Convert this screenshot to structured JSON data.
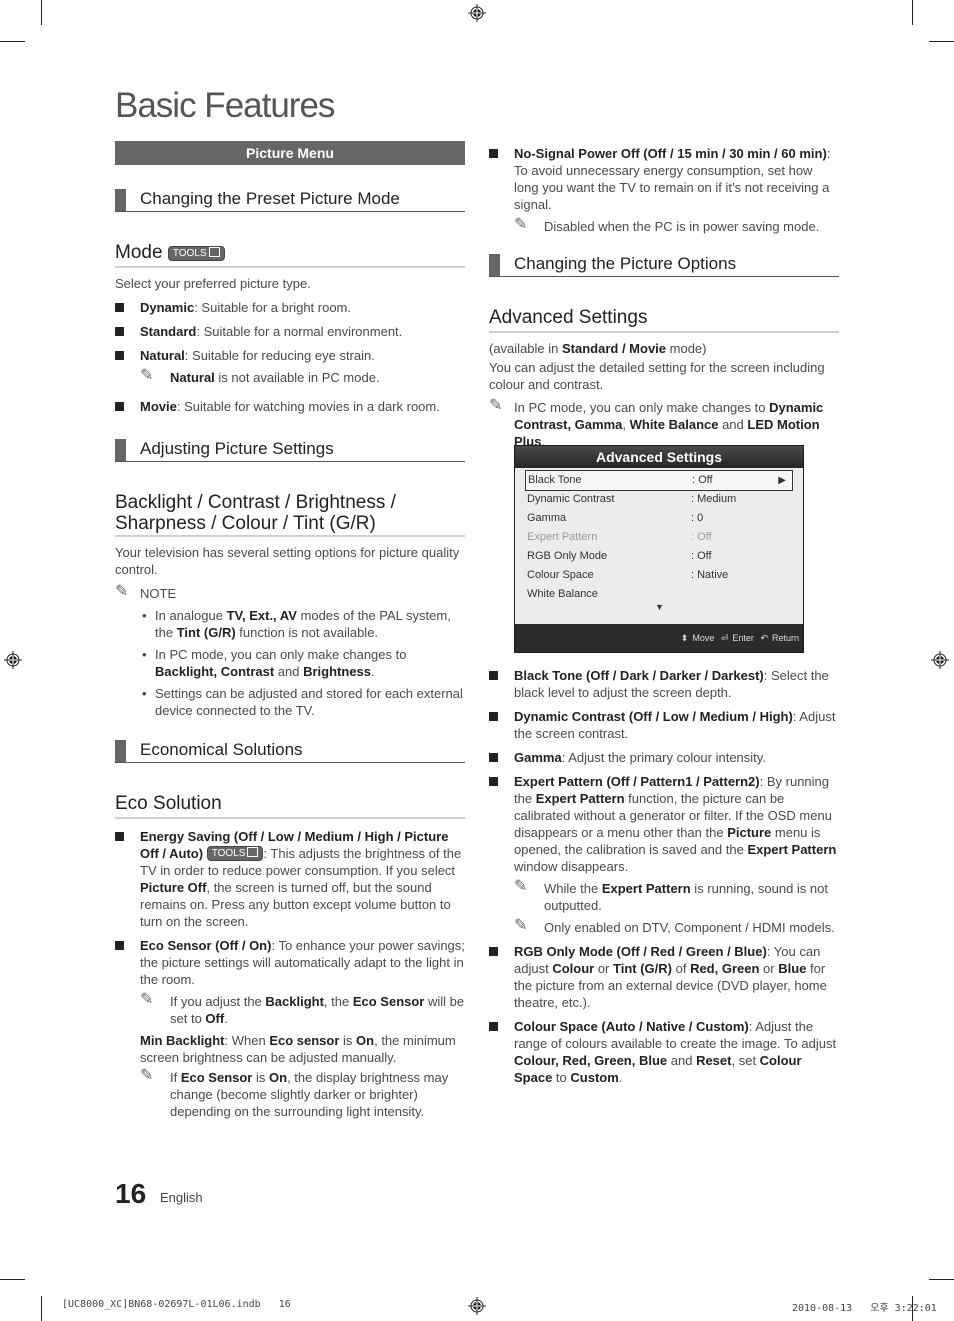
{
  "page": {
    "title": "Basic Features",
    "page_number": "16",
    "language": "English",
    "slug_left": "[UC8000_XC]BN68-02697L-01L06.indb   16",
    "slug_right": "2010-08-13   오후 3:22:01"
  },
  "left": {
    "menu_bar": "Picture Menu",
    "sec1": "Changing the Preset Picture Mode",
    "mode_heading": "Mode",
    "tools_label": "TOOLS",
    "mode_intro": "Select your preferred picture type.",
    "mode_items": [
      {
        "term": "Dynamic",
        "text": ": Suitable for a bright room."
      },
      {
        "term": "Standard",
        "text": ": Suitable for a normal environment."
      },
      {
        "term": "Natural",
        "text": ": Suitable for reducing eye strain."
      },
      {
        "term": "Movie",
        "text": ": Suitable for watching movies in a dark room."
      }
    ],
    "natural_note_term": "Natural",
    "natural_note_text": " is not available in PC mode.",
    "sec2": "Adjusting Picture Settings",
    "backlight_heading_l1": "Backlight / Contrast / Brightness /",
    "backlight_heading_l2": "Sharpness / Colour / Tint (G/R)",
    "backlight_intro": "Your television has several setting options for picture quality control.",
    "note_label": "NOTE",
    "notes": {
      "n1a": "In analogue ",
      "n1b": "TV, Ext., AV",
      "n1c": " modes of the PAL system, the ",
      "n1d": "Tint (G/R)",
      "n1e": " function is not available.",
      "n2a": "In PC mode, you can only make changes to ",
      "n2b": "Backlight, Contrast",
      "n2c": " and ",
      "n2d": "Brightness",
      "n2e": ".",
      "n3": "Settings can be adjusted and stored for each external device connected to the TV."
    },
    "sec3": "Economical Solutions",
    "eco_heading": "Eco Solution",
    "energy": {
      "term1": "Energy Saving (Off / Low / Medium / High / Picture Off / Auto)",
      "t1": ": This adjusts the brightness of the TV in order to reduce power consumption. If you select ",
      "term2": "Picture Off",
      "t2": ", the screen is turned off, but the sound remains on. Press any button except volume button to turn on the screen."
    },
    "eco_sensor": {
      "term": "Eco Sensor (Off / On)",
      "text": ": To enhance your power savings; the picture settings will automatically adapt to the light in the room.",
      "note_a": " If you adjust the ",
      "note_b": "Backlight",
      "note_c": ", the ",
      "note_d": "Eco Sensor",
      "note_e": " will be set to ",
      "note_f": "Off",
      "note_g": ".",
      "min_a": "Min Backlight",
      "min_b": ": When ",
      "min_c": "Eco sensor",
      "min_d": " is ",
      "min_e": "On",
      "min_f": ", the minimum screen brightness can be adjusted manually.",
      "note2_a": "If ",
      "note2_b": "Eco Sensor",
      "note2_c": " is ",
      "note2_d": "On",
      "note2_e": ", the display brightness may change (become slightly darker or brighter) depending on the surrounding light intensity."
    }
  },
  "right": {
    "nosignal_term": "No-Signal Power Off (Off / 15 min / 30 min / 60 min)",
    "nosignal_text": ": To avoid unnecessary energy consumption, set how long you want the TV to remain on if it’s not receiving a signal.",
    "nosignal_note": "Disabled when the PC is in power saving mode.",
    "sec4": "Changing the Picture Options",
    "adv_heading": "Advanced Settings",
    "avail_a": "(available in ",
    "avail_b": "Standard / Movie",
    "avail_c": " mode)",
    "adv_intro": "You can adjust the detailed setting for the screen including colour and contrast.",
    "pc_note_a": "In PC mode, you can only make changes to ",
    "pc_note_b": "Dynamic Contrast, Gamma",
    "pc_note_c": ", ",
    "pc_note_d": "White Balance",
    "pc_note_e": " and ",
    "pc_note_f": "LED Motion Plus",
    "pc_note_g": ".",
    "osd": {
      "title": "Advanced Settings",
      "rows": [
        {
          "label": "Black Tone",
          "value": ": Off"
        },
        {
          "label": "Dynamic Contrast",
          "value": ": Medium"
        },
        {
          "label": "Gamma",
          "value": ": 0"
        },
        {
          "label": "Expert Pattern",
          "value": ": Off"
        },
        {
          "label": "RGB Only Mode",
          "value": ": Off"
        },
        {
          "label": "Colour Space",
          "value": ": Native"
        },
        {
          "label": "White Balance",
          "value": ""
        }
      ],
      "move": "Move",
      "enter": "Enter",
      "return": "Return"
    },
    "items": {
      "black_term": "Black Tone (Off / Dark / Darker / Darkest)",
      "black_text": ": Select the black level to adjust the screen depth.",
      "dyn_term": "Dynamic Contrast (Off / Low / Medium / High)",
      "dyn_text": ": Adjust the screen contrast.",
      "gamma_term": "Gamma",
      "gamma_text": ": Adjust the primary colour intensity.",
      "expert_term": "Expert Pattern (Off / Pattern1 / Pattern2)",
      "expert_a": ": By running the ",
      "expert_b": "Expert Pattern",
      "expert_c": " function, the picture can be calibrated without a generator or filter. If the OSD menu disappears or a menu other than the ",
      "expert_d": "Picture",
      "expert_e": " menu is opened, the calibration is saved and the ",
      "expert_f": "Expert Pattern",
      "expert_g": " window disappears.",
      "expert_note1_a": "While the ",
      "expert_note1_b": "Expert Pattern",
      "expert_note1_c": " is running, sound is not outputted.",
      "expert_note2": "Only enabled on DTV, Component / HDMI models.",
      "rgb_term": "RGB Only Mode (Off / Red / Green / Blue)",
      "rgb_a": ": You can adjust ",
      "rgb_b": "Colour",
      "rgb_c": " or ",
      "rgb_d": "Tint (G/R)",
      "rgb_e": " of ",
      "rgb_f": "Red, Green",
      "rgb_g": " or ",
      "rgb_h": "Blue",
      "rgb_i": " for the picture from an external device (DVD player, home theatre, etc.).",
      "cs_term": "Colour Space (Auto / Native / Custom)",
      "cs_a": ": Adjust the range of colours available to create the image. To adjust ",
      "cs_b": "Colour, Red, Green, Blue",
      "cs_c": " and ",
      "cs_d": "Reset",
      "cs_e": ", set ",
      "cs_f": "Colour Space",
      "cs_g": " to ",
      "cs_h": "Custom",
      "cs_i": "."
    }
  }
}
